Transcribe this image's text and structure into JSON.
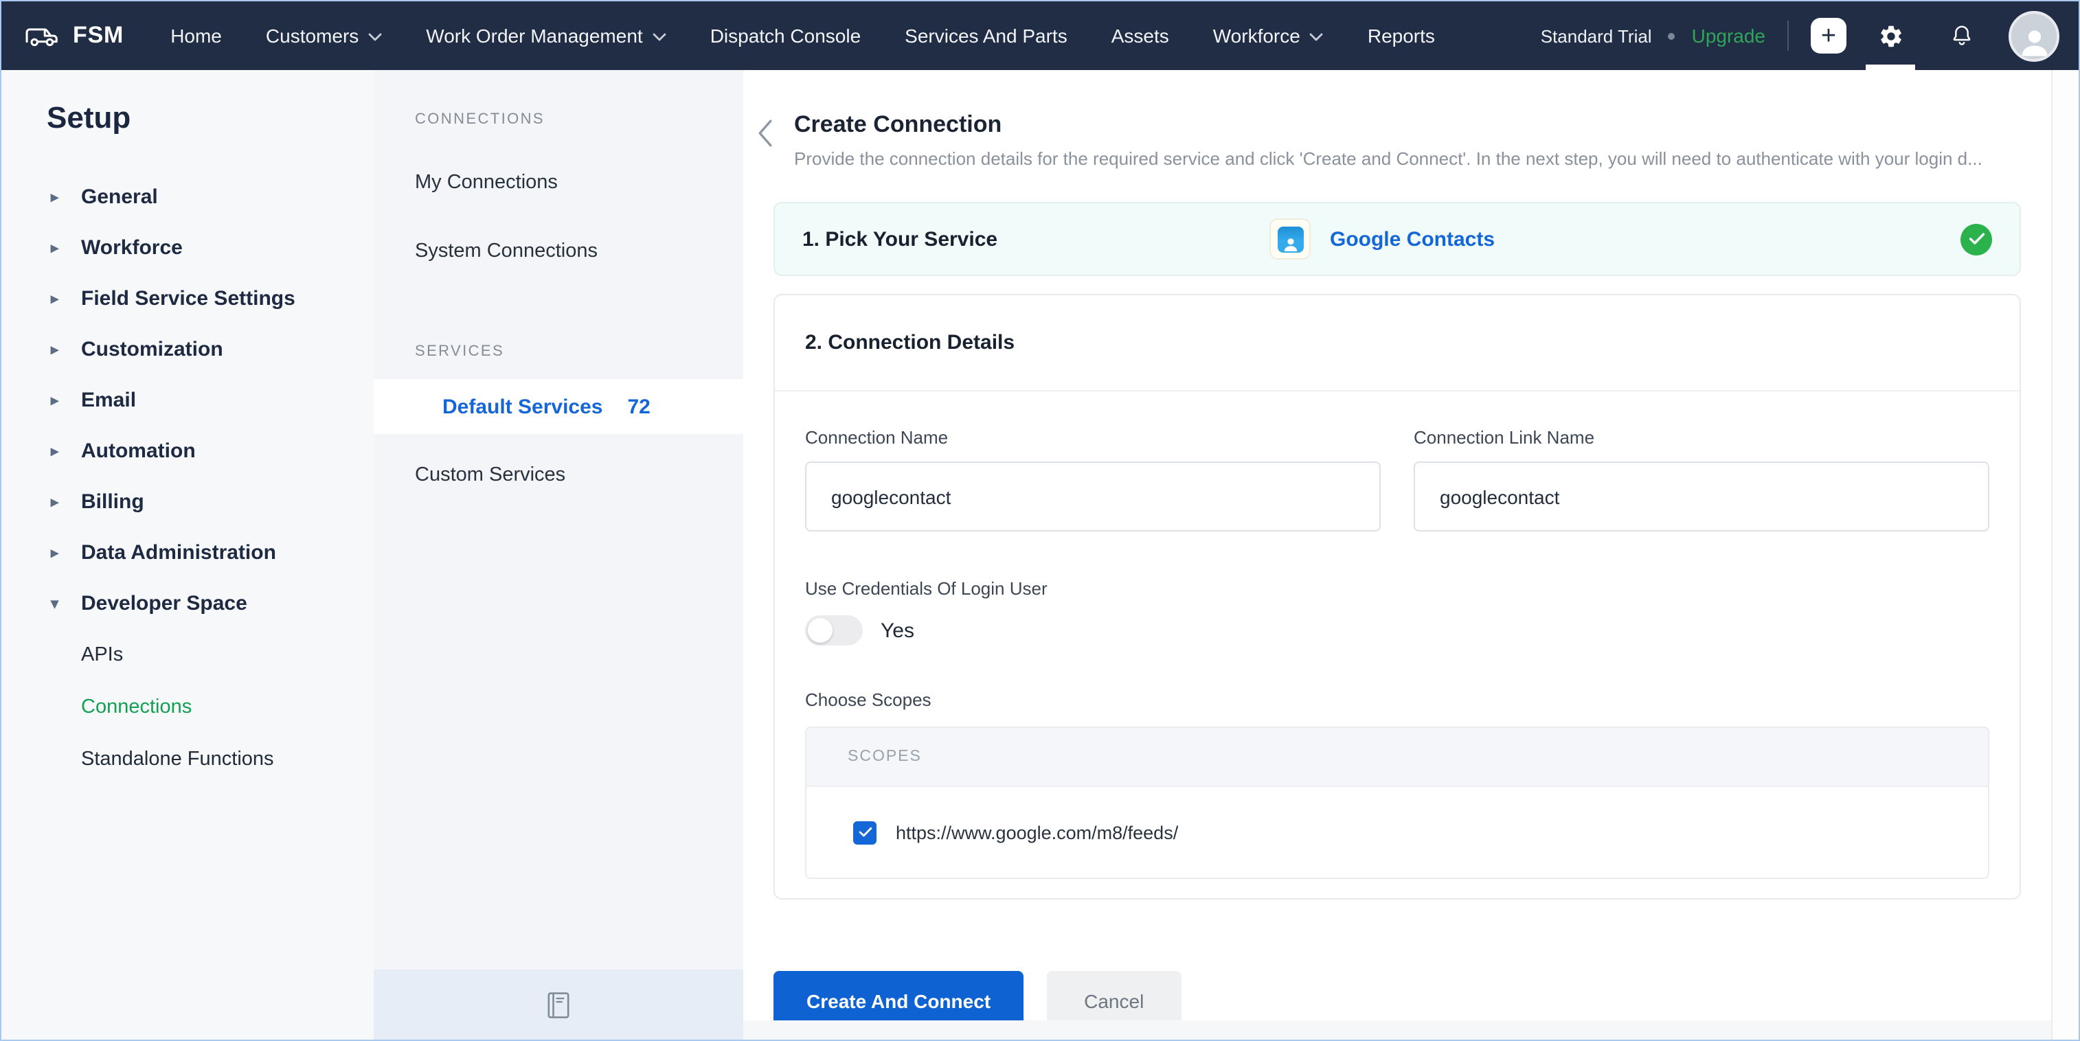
{
  "topnav": {
    "brand": "FSM",
    "items": [
      {
        "label": "Home",
        "dropdown": false
      },
      {
        "label": "Customers",
        "dropdown": true
      },
      {
        "label": "Work Order Management",
        "dropdown": true
      },
      {
        "label": "Dispatch Console",
        "dropdown": false
      },
      {
        "label": "Services And Parts",
        "dropdown": false
      },
      {
        "label": "Assets",
        "dropdown": false
      },
      {
        "label": "Workforce",
        "dropdown": true
      },
      {
        "label": "Reports",
        "dropdown": false
      }
    ],
    "plan_label": "Standard Trial",
    "upgrade_label": "Upgrade"
  },
  "sidebar": {
    "title": "Setup",
    "items": [
      {
        "label": "General"
      },
      {
        "label": "Workforce"
      },
      {
        "label": "Field Service Settings"
      },
      {
        "label": "Customization"
      },
      {
        "label": "Email"
      },
      {
        "label": "Automation"
      },
      {
        "label": "Billing"
      },
      {
        "label": "Data Administration"
      },
      {
        "label": "Developer Space"
      }
    ],
    "children": [
      {
        "label": "APIs"
      },
      {
        "label": "Connections",
        "active": true
      },
      {
        "label": "Standalone Functions"
      }
    ]
  },
  "panel": {
    "connections_header": "CONNECTIONS",
    "my_connections": "My Connections",
    "system_connections": "System Connections",
    "services_header": "SERVICES",
    "default_services": "Default Services",
    "default_services_count": "72",
    "custom_services": "Custom Services"
  },
  "content": {
    "title": "Create Connection",
    "subtitle": "Provide the connection details for the required service and click 'Create and Connect'. In the next step, you will need to authenticate with your login d...",
    "step1": {
      "title": "1. Pick Your Service",
      "service_name": "Google Contacts"
    },
    "step2": {
      "title": "2. Connection Details",
      "connection_name_label": "Connection Name",
      "connection_name_value": "googlecontact",
      "connection_link_name_label": "Connection Link Name",
      "connection_link_name_value": "googlecontact",
      "use_credentials_label": "Use Credentials Of Login User",
      "toggle_value": "Yes",
      "choose_scopes_label": "Choose Scopes",
      "scopes_header": "SCOPES",
      "scope_url": "https://www.google.com/m8/feeds/"
    },
    "buttons": {
      "create": "Create And Connect",
      "cancel": "Cancel"
    }
  },
  "icons": {
    "plus": "+",
    "collapsed": "▸",
    "expanded": "▾"
  },
  "colors": {
    "nav_bg": "#212d44",
    "accent_blue": "#1566d7",
    "button_blue": "#0e62d1",
    "active_green": "#12a053",
    "upgrade_green": "#2fa45a",
    "check_green": "#2cb24c",
    "step1_bg": "#f1fbf9"
  }
}
